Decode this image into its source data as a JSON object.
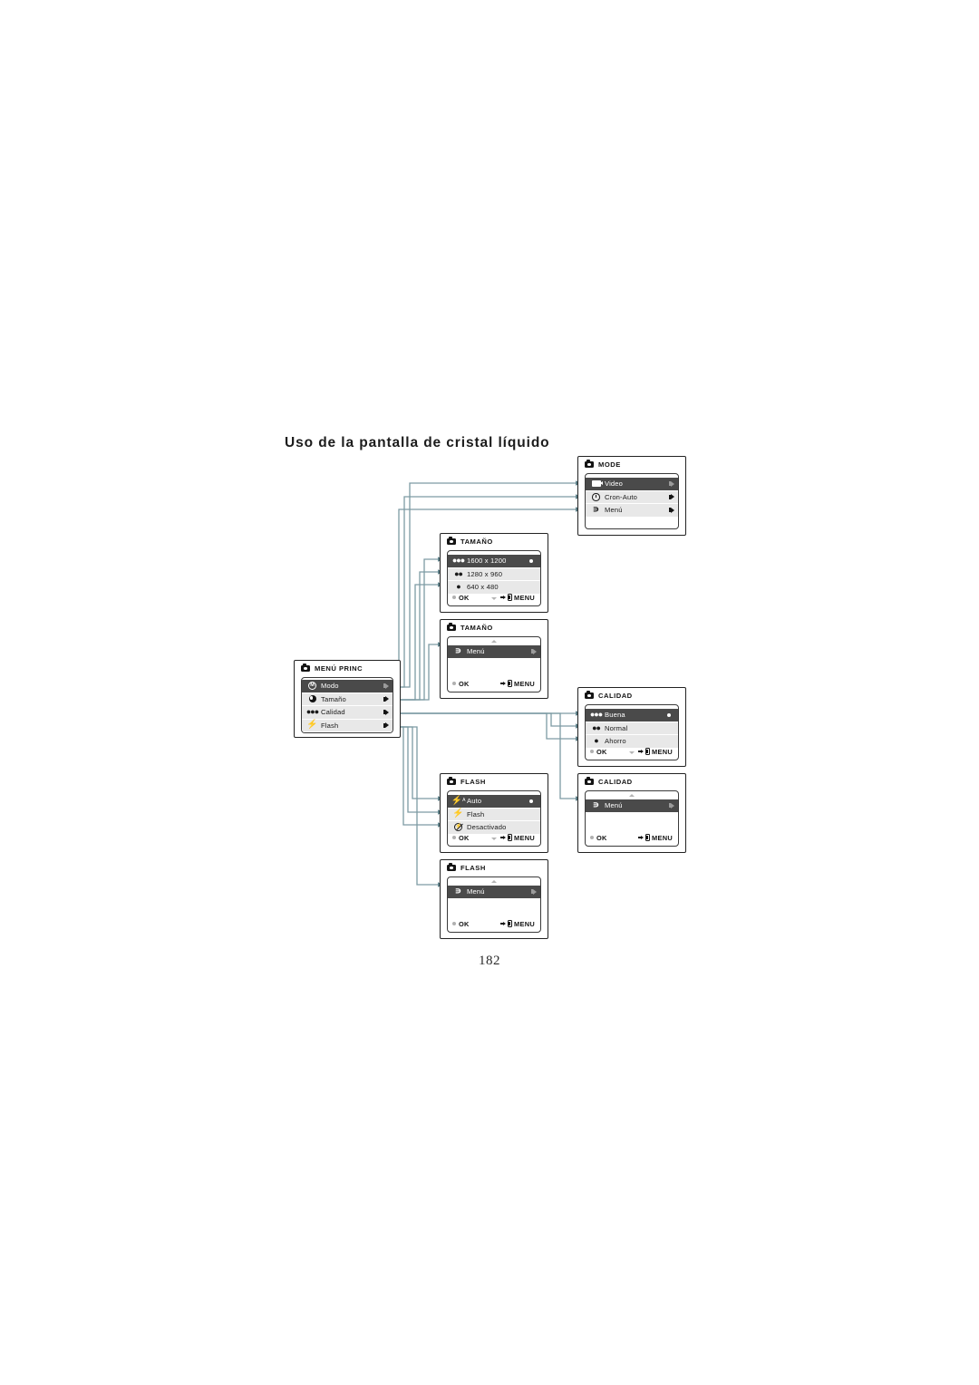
{
  "heading": "Uso de la pantalla de cristal líquido",
  "folio": "182",
  "common": {
    "ok_label": "OK",
    "menu_label": "MENU",
    "camera_icon": "camera-icon",
    "back_icon": "back-arrow-icon",
    "right_arrow_icon": "right-arrow-icon"
  },
  "panels": {
    "mode": {
      "title": "MODE",
      "rows": [
        {
          "label": "Video",
          "icon": "video-camera-icon",
          "selected": true
        },
        {
          "label": "Cron-Auto",
          "icon": "self-timer-icon",
          "selected": false
        },
        {
          "label": "Menú",
          "icon": "back-arrow-icon",
          "selected": false
        }
      ],
      "has_footer": false
    },
    "tamano_list": {
      "title": "TAMAÑO",
      "rows": [
        {
          "label": "1600 x 1200",
          "icon": "three-dots-icon",
          "selected": true,
          "dot": true
        },
        {
          "label": "1280 x 960",
          "icon": "two-dots-icon",
          "selected": false
        },
        {
          "label": "640 x 480",
          "icon": "one-dot-icon",
          "selected": false
        }
      ],
      "ok_label": "OK",
      "menu_label": "MENU",
      "scroll": "down"
    },
    "tamano_exit": {
      "title": "TAMAÑO",
      "rows": [
        {
          "label": "Menú",
          "icon": "back-arrow-icon",
          "selected": true,
          "arrow": "dim"
        }
      ],
      "ok_label": "OK",
      "menu_label": "MENU",
      "scroll": "up"
    },
    "menu_princ": {
      "title": "MENÚ PRINC",
      "rows": [
        {
          "label": "Modo",
          "icon": "mode-dial-icon",
          "selected": true,
          "arrow": "dim"
        },
        {
          "label": "Tamaño",
          "icon": "lens-icon",
          "selected": false
        },
        {
          "label": "Calidad",
          "icon": "three-dots-icon",
          "selected": false
        },
        {
          "label": "Flash",
          "icon": "flash-icon",
          "selected": false
        }
      ],
      "has_footer": false,
      "scroll": "down"
    },
    "calidad_list": {
      "title": "CALIDAD",
      "rows": [
        {
          "label": "Buena",
          "icon": "three-dots-icon",
          "selected": true,
          "dot": true
        },
        {
          "label": "Normal",
          "icon": "two-dots-icon",
          "selected": false
        },
        {
          "label": "Ahorro",
          "icon": "one-dot-icon",
          "selected": false
        }
      ],
      "ok_label": "OK",
      "menu_label": "MENU",
      "scroll": "down"
    },
    "calidad_exit": {
      "title": "CALIDAD",
      "rows": [
        {
          "label": "Menú",
          "icon": "back-arrow-icon",
          "selected": true,
          "arrow": "dim"
        }
      ],
      "ok_label": "OK",
      "menu_label": "MENU",
      "scroll": "up"
    },
    "flash_list": {
      "title": "FLASH",
      "rows": [
        {
          "label": "Auto",
          "icon": "flash-auto-icon",
          "selected": true,
          "dot": true
        },
        {
          "label": "Flash",
          "icon": "flash-icon",
          "selected": false
        },
        {
          "label": "Desactivado",
          "icon": "no-flash-icon",
          "selected": false
        }
      ],
      "ok_label": "OK",
      "menu_label": "MENU",
      "scroll": "down"
    },
    "flash_exit": {
      "title": "FLASH",
      "rows": [
        {
          "label": "Menú",
          "icon": "back-arrow-icon",
          "selected": true,
          "arrow": "dim"
        }
      ],
      "ok_label": "OK",
      "menu_label": "MENU",
      "scroll": "up"
    }
  },
  "colors": {
    "wire": "#7d9ba3",
    "selected_row": "#4a4a4a",
    "row": "#e8e8e8",
    "border": "#222222"
  }
}
